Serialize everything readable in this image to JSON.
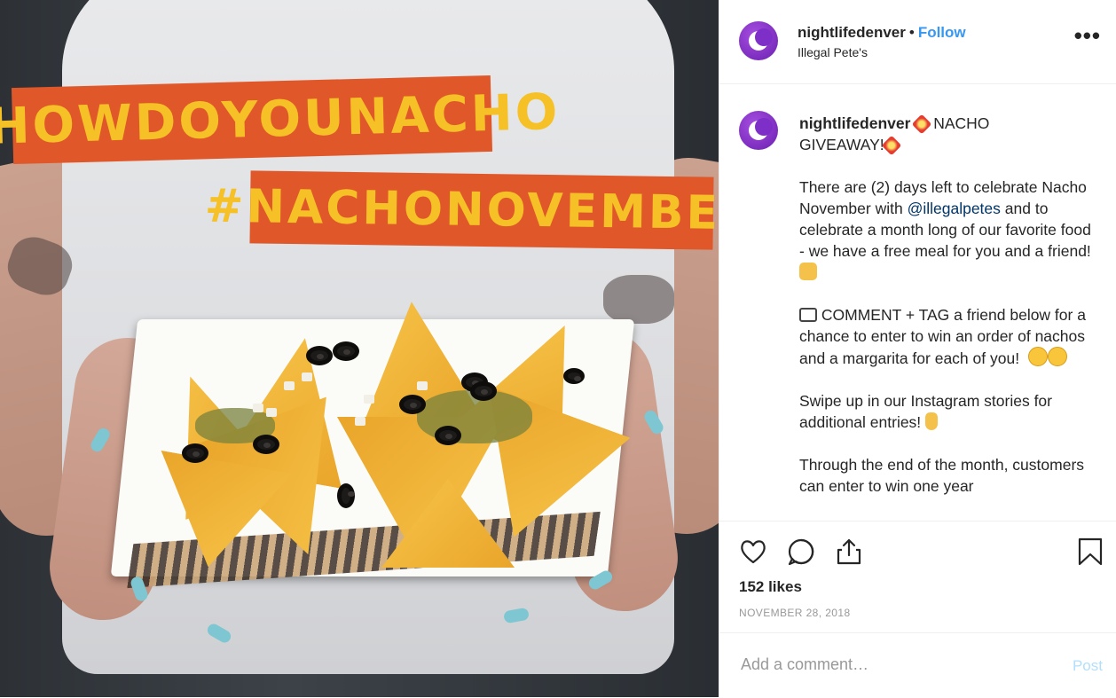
{
  "photo": {
    "hashtag_one": "#HOWDOYOUNACHO",
    "hashtag_two": "#NACHONOVEMBER"
  },
  "header": {
    "username": "nightlifedenver",
    "separator": "•",
    "follow_label": "Follow",
    "location": "Illegal Pete's",
    "more_label": "•••"
  },
  "caption": {
    "username": "nightlifedenver",
    "headline_a": "NACHO",
    "headline_b": "GIVEAWAY!",
    "p1_a": "There are (2) days left to celebrate Nacho November with ",
    "p1_mention": "@illegalpetes",
    "p1_b": " and to celebrate a month long of our favorite food - we have a free meal for you and a friend!",
    "p2": " COMMENT + TAG a friend below for a chance to enter to win an order of nachos and a margarita for each of you!",
    "p3": "Swipe up in our Instagram stories for additional entries! ",
    "p4": "Through the end of the month, customers can enter to win one year"
  },
  "actions": {
    "likes": "152 likes",
    "date": "NOVEMBER 28, 2018"
  },
  "comment": {
    "placeholder": "Add a comment…",
    "post_label": "Post"
  },
  "colors": {
    "link": "#3897f0",
    "post_disabled": "#b2dffc",
    "avatar_purple": "#7e2fc7",
    "banner_orange": "#e0582a",
    "banner_text": "#f6c126"
  }
}
